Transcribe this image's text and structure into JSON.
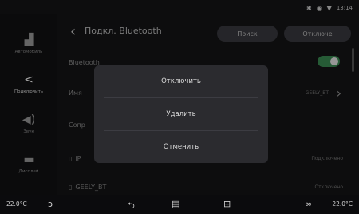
{
  "status": {
    "time": "13:14",
    "icons": [
      "bluetooth-icon",
      "signal-icon",
      "wifi-icon"
    ]
  },
  "sidebar": {
    "items": [
      {
        "label": "Автомобиль",
        "icon": "car-icon",
        "active": false
      },
      {
        "label": "Подключить",
        "icon": "share-icon",
        "active": true
      },
      {
        "label": "Звук",
        "icon": "speaker-icon",
        "active": false
      },
      {
        "label": "Дисплей",
        "icon": "display-icon",
        "active": false
      }
    ]
  },
  "header": {
    "title": "Подкл. Bluetooth",
    "search_label": "Поиск",
    "unpair_label": "Отключе"
  },
  "list": {
    "bluetooth_label": "Bluetooth",
    "name_label": "Имя",
    "name_value": "GEELY_BT",
    "paired_label": "Сопр",
    "device1_label": "iP",
    "device1_status": "Подключено",
    "device2_label": "GEELY_BT",
    "device2_status": "Отключено"
  },
  "dialog": {
    "disconnect_label": "Отключить",
    "delete_label": "Удалить",
    "cancel_label": "Отменить"
  },
  "bottom": {
    "temp_left": "22.0°C",
    "temp_right": "22.0°C"
  }
}
